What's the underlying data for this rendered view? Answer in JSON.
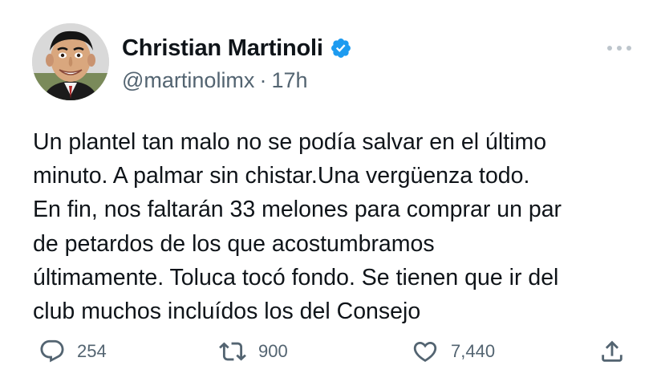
{
  "tweet": {
    "author": {
      "display_name": "Christian Martinoli",
      "handle": "@martinolimx",
      "verified_icon": "verified-badge-icon",
      "avatar": "caricature-portrait"
    },
    "timestamp": "17h",
    "separator": "·",
    "more_icon": "more-horizontal-icon",
    "body_lines": [
      "Un plantel tan malo no se podía salvar en el último",
      "minuto. A palmar sin chistar.Una vergüenza todo.",
      "En fin, nos faltarán 33 melones para comprar un par",
      "de petardos de los que acostumbramos",
      "últimamente. Toluca tocó fondo. Se tienen que ir del",
      "club muchos incluídos los del Consejo"
    ],
    "actions": {
      "reply": {
        "icon": "reply-icon",
        "count": "254"
      },
      "retweet": {
        "icon": "retweet-icon",
        "count": "900"
      },
      "like": {
        "icon": "like-icon",
        "count": "7,440"
      },
      "share": {
        "icon": "share-icon"
      }
    },
    "colors": {
      "verified": "#1d9bf0",
      "text": "#0f1419",
      "secondary": "#536471"
    }
  }
}
